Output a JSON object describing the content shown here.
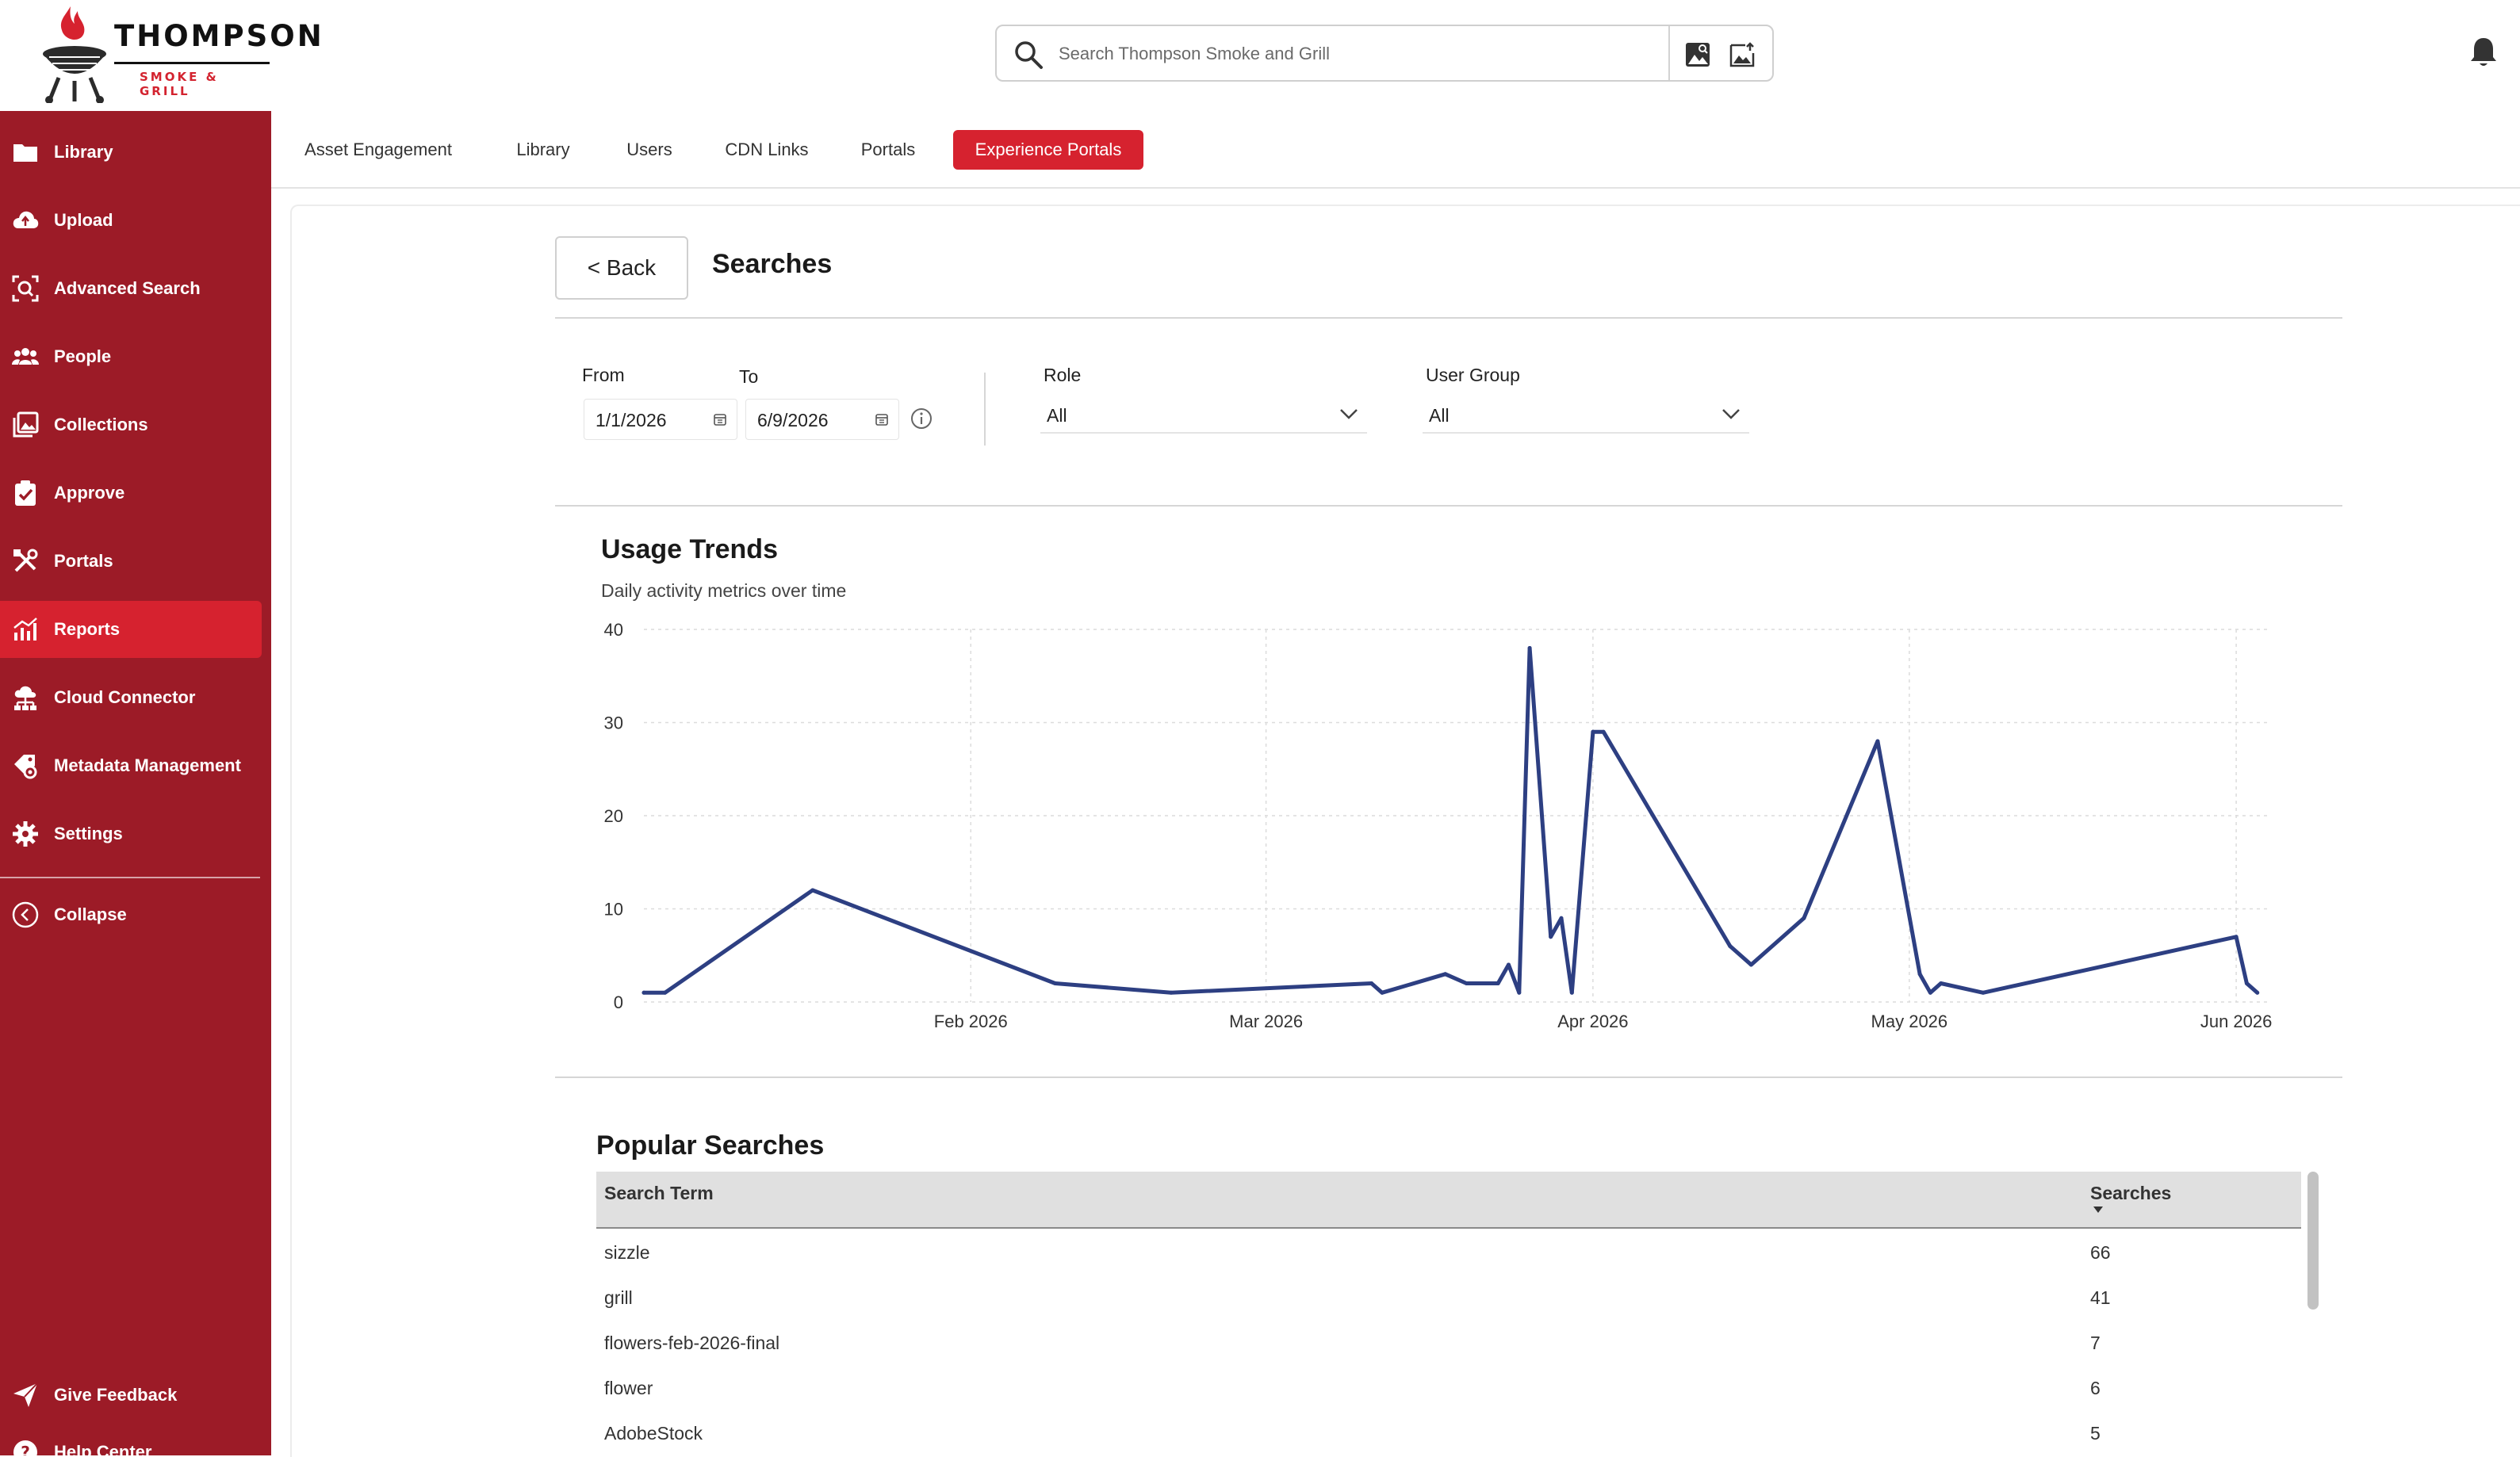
{
  "brand": {
    "name": "THOMPSON",
    "tagline": "SMOKE & GRILL",
    "colors": {
      "primary": "#d6222f",
      "sidebar": "#9c1b27",
      "chart_line": "#2d3f82"
    }
  },
  "header": {
    "search_placeholder": "Search Thompson Smoke and Grill",
    "icons": [
      "search-icon",
      "image-search-icon",
      "image-upload-icon",
      "bell-icon"
    ]
  },
  "sidebar": {
    "items": [
      {
        "label": "Library",
        "icon": "folder-icon",
        "active": false
      },
      {
        "label": "Upload",
        "icon": "cloud-upload-icon",
        "active": false
      },
      {
        "label": "Advanced Search",
        "icon": "scan-search-icon",
        "active": false
      },
      {
        "label": "People",
        "icon": "people-icon",
        "active": false
      },
      {
        "label": "Collections",
        "icon": "collections-icon",
        "active": false
      },
      {
        "label": "Approve",
        "icon": "clipboard-check-icon",
        "active": false
      },
      {
        "label": "Portals",
        "icon": "tools-icon",
        "active": false
      },
      {
        "label": "Reports",
        "icon": "bar-chart-icon",
        "active": true
      },
      {
        "label": "Cloud Connector",
        "icon": "cloud-connector-icon",
        "active": false
      },
      {
        "label": "Metadata Management",
        "icon": "tag-gear-icon",
        "active": false
      },
      {
        "label": "Settings",
        "icon": "gear-icon",
        "active": false
      }
    ],
    "collapse_label": "Collapse",
    "feedback_label": "Give Feedback",
    "help_label": "Help Center"
  },
  "tabs": [
    {
      "label": "Asset Engagement",
      "active": false
    },
    {
      "label": "Library",
      "active": false
    },
    {
      "label": "Users",
      "active": false
    },
    {
      "label": "CDN Links",
      "active": false
    },
    {
      "label": "Portals",
      "active": false
    },
    {
      "label": "Experience Portals",
      "active": true
    }
  ],
  "page": {
    "back_label": "< Back",
    "title": "Searches"
  },
  "filters": {
    "from_label": "From",
    "from_value": "1/1/2026",
    "to_label": "To",
    "to_value": "6/9/2026",
    "role_label": "Role",
    "role_value": "All",
    "group_label": "User Group",
    "group_value": "All"
  },
  "usage": {
    "title": "Usage Trends",
    "subtitle": "Daily activity metrics over time"
  },
  "chart_data": {
    "type": "line",
    "x_type": "date",
    "x_range": [
      "2026-01-01",
      "2026-06-04"
    ],
    "ylim": [
      0,
      40
    ],
    "y_ticks": [
      0,
      10,
      20,
      30,
      40
    ],
    "x_ticks": [
      {
        "date": "2026-02-01",
        "label": "Feb 2026"
      },
      {
        "date": "2026-03-01",
        "label": "Mar 2026"
      },
      {
        "date": "2026-04-01",
        "label": "Apr 2026"
      },
      {
        "date": "2026-05-01",
        "label": "May 2026"
      },
      {
        "date": "2026-06-01",
        "label": "Jun 2026"
      }
    ],
    "grid": true,
    "series": [
      {
        "x": [
          "2026-01-01",
          "2026-01-03",
          "2026-01-17",
          "2026-02-09",
          "2026-02-20",
          "2026-03-11",
          "2026-03-12",
          "2026-03-18",
          "2026-03-20",
          "2026-03-23",
          "2026-03-24",
          "2026-03-25",
          "2026-03-26",
          "2026-03-28",
          "2026-03-29",
          "2026-03-30",
          "2026-04-01",
          "2026-04-02",
          "2026-04-14",
          "2026-04-16",
          "2026-04-21",
          "2026-04-28",
          "2026-05-02",
          "2026-05-03",
          "2026-05-04",
          "2026-05-08",
          "2026-06-01",
          "2026-06-02",
          "2026-06-03"
        ],
        "y": [
          1,
          1,
          12,
          2,
          1,
          2,
          1,
          3,
          2,
          2,
          4,
          1,
          38,
          7,
          9,
          1,
          29,
          29,
          6,
          4,
          9,
          28,
          3,
          1,
          2,
          1,
          7,
          2,
          1
        ]
      }
    ]
  },
  "popular": {
    "title": "Popular Searches",
    "col_term": "Search Term",
    "col_count": "Searches",
    "rows": [
      {
        "term": "sizzle",
        "count": "66"
      },
      {
        "term": "grill",
        "count": "41"
      },
      {
        "term": "flowers-feb-2026-final",
        "count": "7"
      },
      {
        "term": "flower",
        "count": "6"
      },
      {
        "term": "AdobeStock",
        "count": "5"
      }
    ]
  }
}
